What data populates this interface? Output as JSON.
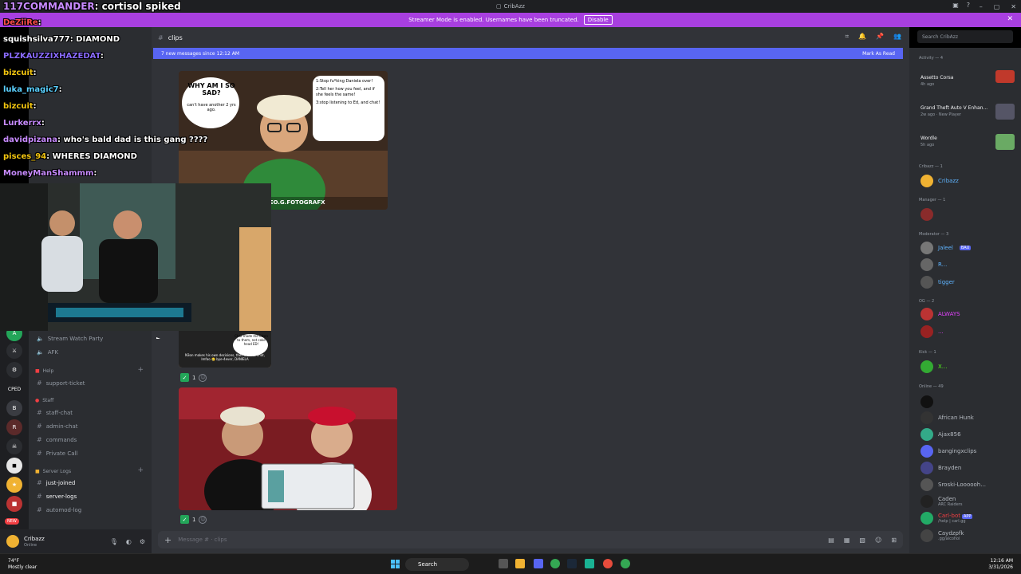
{
  "window": {
    "title": "CribAzz"
  },
  "banner": {
    "text": "Streamer Mode is enabled. Usernames have been truncated.",
    "button": "Disable"
  },
  "channel": {
    "name": "clips",
    "new_messages": "7 new messages since 12:12 AM",
    "mark_read": "Mark As Read",
    "composer_placeholder": "Message #  · clips"
  },
  "search": {
    "placeholder": "Search CribAzz"
  },
  "twitch_chat": [
    {
      "nick": "117COMMANDER",
      "msg": ": cortisol spiked"
    },
    {
      "nick": "DeZiiRe",
      "msg": ":"
    },
    {
      "nick": "squishsilva777",
      "msg": ": DIAMOND"
    },
    {
      "nick": "PLZKAUZZIXHAZEDAT",
      "msg": ":"
    },
    {
      "nick": "bizcuit",
      "msg": ":"
    },
    {
      "nick": "luka_magic7",
      "msg": ":"
    },
    {
      "nick": "bizcuit",
      "msg": ":"
    },
    {
      "nick": "Lurkerrx",
      "msg": ":"
    },
    {
      "nick": "davidpizana",
      "msg": ": who's bald dad is this gang ????"
    },
    {
      "nick": "pisces_94",
      "msg": ": WHERES DIAMOND"
    },
    {
      "nick": "MoneyManShammm",
      "msg": ":"
    }
  ],
  "sidebar": {
    "channels": [
      {
        "name": "Stream Watch Party"
      },
      {
        "name": "AFK"
      },
      {
        "name": "support-ticket"
      },
      {
        "name": "staff-chat"
      },
      {
        "name": "admin-chat"
      },
      {
        "name": "commands"
      },
      {
        "name": "Private Call"
      },
      {
        "name": "just-joined"
      },
      {
        "name": "server-logs"
      },
      {
        "name": "automod-log"
      }
    ],
    "categories": {
      "help": "Help",
      "staff": "Staff",
      "server_logs": "Server Logs"
    },
    "rail_label": "CPED",
    "rail_new": "NEW"
  },
  "user": {
    "name": "Cribazz",
    "status": "Online"
  },
  "messages": {
    "img1_watermark": ": LEO.G.FOTOGRAFX",
    "img1_caption1": "WHY AM I SO SAD?",
    "img1_caption1b": "can't have another 2 yrs ago.",
    "img1_list": [
      "1:Stop fu*king Daniela over!",
      "2:Tell her how you feel, and if she feels the same!",
      "3:stop listening to Ed, and chat!"
    ],
    "img2_caption": "N3on makes his own decisions, then blames chat, lmfao 🥲 bye-4ever, DANIELA",
    "img2_bubble": "Chat made me listen to them, not coke head ED!",
    "reaction_count": "1"
  },
  "members": {
    "activity_header": "Activity — 4",
    "activities": [
      {
        "title": "Assetto Corsa",
        "sub": "4h ago"
      },
      {
        "title": "Grand Theft Auto V Enhan...",
        "sub": "2w ago · New Player"
      },
      {
        "title": "Wordle",
        "sub": "5h ago"
      }
    ],
    "groups": [
      {
        "header": "Cribazz — 1",
        "names": [
          "Cribazz"
        ]
      },
      {
        "header": "Manager — 1",
        "names": [
          ""
        ]
      },
      {
        "header": "Moderator — 3",
        "names": [
          "Jaleel",
          "R...",
          "tigger"
        ]
      },
      {
        "header": "OG — 2",
        "names": [
          "ALWAYS",
          "..."
        ]
      },
      {
        "header": "Kick — 1",
        "names": [
          "X..."
        ]
      },
      {
        "header": "Online — 49",
        "names": [
          "",
          "African Hunk",
          "Ajax856",
          "bangingxclips",
          "Brayden",
          "Sroski-Loooooh...",
          "Caden",
          "Carl-bot",
          "Caydzpfk"
        ]
      }
    ],
    "subs": {
      "caden": "ARC Raiders",
      "carlbot": "/help | carl.gg",
      "caydz": ".gg/alcohol"
    },
    "badges": {
      "bau": "BAU",
      "app": "APP"
    }
  },
  "taskbar": {
    "weather_temp": "74°F",
    "weather_desc": "Mostly clear",
    "search": "Search",
    "time": "12:16 AM",
    "date": "3/31/2026"
  },
  "colors": {
    "accent": "#5865f2",
    "banner": "#a83fe0",
    "online": "#23a559"
  }
}
